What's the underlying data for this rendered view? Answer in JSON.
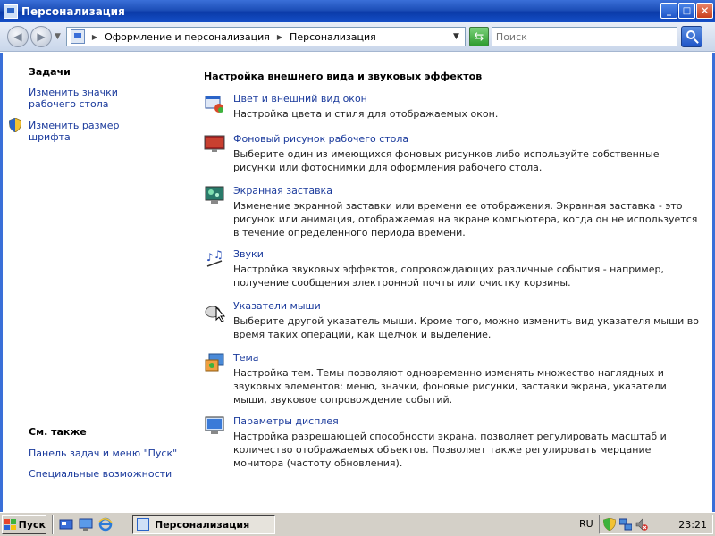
{
  "window": {
    "title": "Персонализация",
    "buttons": {
      "minimize": "_",
      "maximize": "□",
      "close": "✕"
    }
  },
  "nav": {
    "breadcrumb": [
      "Оформление и персонализация",
      "Персонализация"
    ],
    "search_placeholder": "Поиск"
  },
  "sidebar": {
    "tasks_title": "Задачи",
    "tasks": [
      {
        "label": "Изменить значки рабочего стола"
      },
      {
        "label": "Изменить размер шрифта"
      }
    ],
    "see_also_title": "См. также",
    "see_also": [
      {
        "label": "Панель задач и меню \"Пуск\""
      },
      {
        "label": "Специальные возможности"
      }
    ]
  },
  "main": {
    "title": "Настройка внешнего вида и звуковых эффектов",
    "items": [
      {
        "title": "Цвет и внешний вид окон",
        "desc": "Настройка цвета и стиля для отображаемых окон.",
        "icon": "window-color-icon"
      },
      {
        "title": "Фоновый рисунок рабочего стола",
        "desc": "Выберите один из имеющихся фоновых рисунков либо используйте собственные рисунки или фотоснимки для оформления рабочего стола.",
        "icon": "wallpaper-icon"
      },
      {
        "title": "Экранная заставка",
        "desc": "Изменение экранной заставки или времени ее отображения. Экранная заставка - это рисунок или анимация, отображаемая на экране компьютера, когда он не используется в течение определенного периода времени.",
        "icon": "screensaver-icon"
      },
      {
        "title": "Звуки",
        "desc": "Настройка звуковых эффектов, сопровождающих различные события - например, получение сообщения электронной почты или очистку корзины.",
        "icon": "sounds-icon"
      },
      {
        "title": "Указатели мыши",
        "desc": "Выберите другой указатель мыши. Кроме того, можно изменить вид указателя мыши во время таких операций, как щелчок и выделение.",
        "icon": "mouse-pointer-icon"
      },
      {
        "title": "Тема",
        "desc": "Настройка тем. Темы позволяют одновременно изменять множество наглядных и звуковых элементов: меню, значки, фоновые рисунки, заставки экрана, указатели мыши, звуковое сопровождение событий.",
        "icon": "theme-icon"
      },
      {
        "title": "Параметры дисплея",
        "desc": "Настройка разрешающей способности экрана, позволяет регулировать масштаб и количество отображаемых объектов. Позволяет также регулировать мерцание монитора (частоту обновления).",
        "icon": "display-icon"
      }
    ]
  },
  "taskbar": {
    "start_label": "Пуск",
    "active_task": "Персонализация",
    "language": "RU",
    "clock": "23:21"
  }
}
